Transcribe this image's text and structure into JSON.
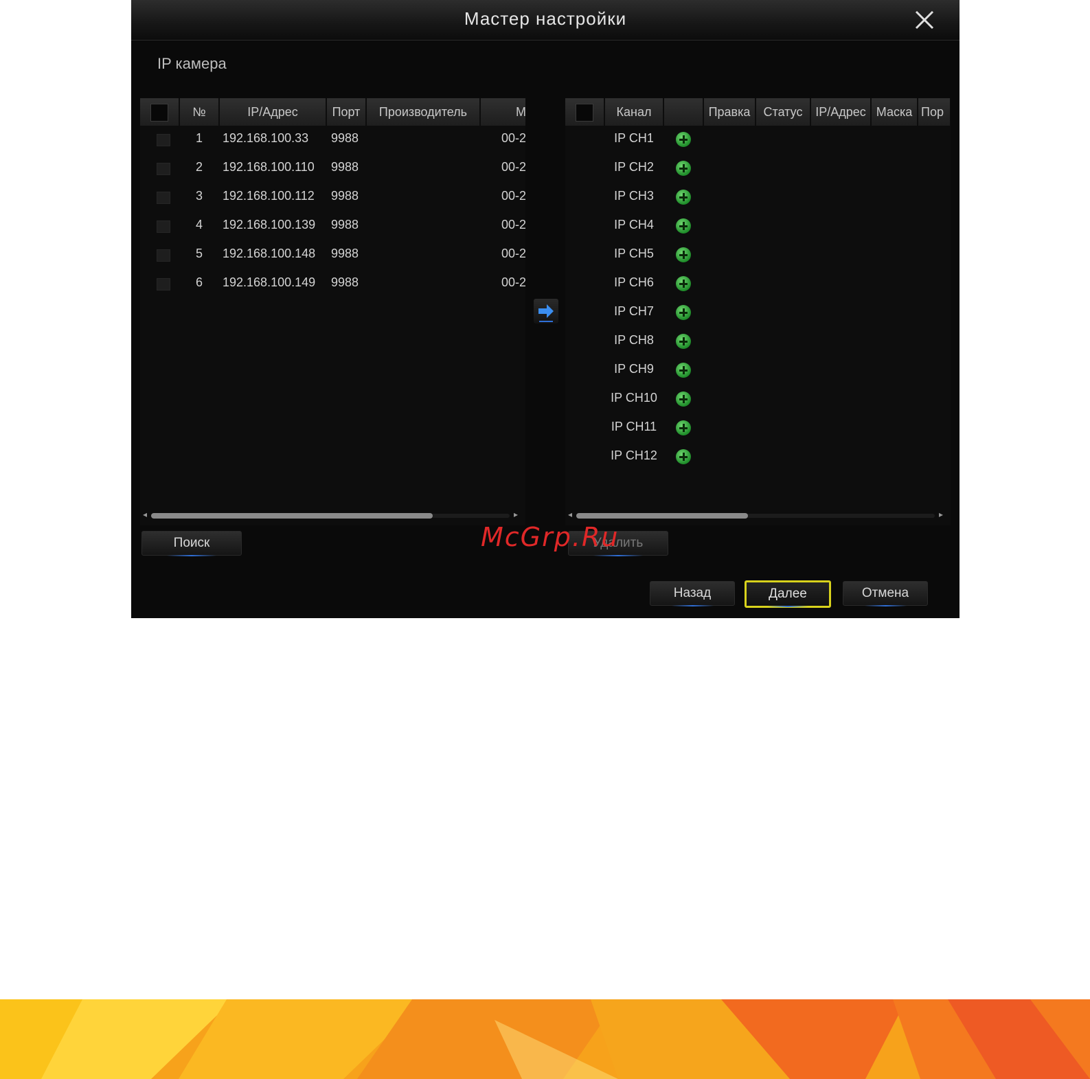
{
  "dialog": {
    "title": "Мастер настройки",
    "section_title": "IP камера"
  },
  "left_table": {
    "headers": [
      "№",
      "IP/Адрес",
      "Порт",
      "Производитель",
      "M"
    ],
    "rows": [
      {
        "no": "1",
        "ip": "192.168.100.33",
        "port": "9988",
        "mac": "00-2"
      },
      {
        "no": "2",
        "ip": "192.168.100.110",
        "port": "9988",
        "mac": "00-2"
      },
      {
        "no": "3",
        "ip": "192.168.100.112",
        "port": "9988",
        "mac": "00-2"
      },
      {
        "no": "4",
        "ip": "192.168.100.139",
        "port": "9988",
        "mac": "00-2"
      },
      {
        "no": "5",
        "ip": "192.168.100.148",
        "port": "9988",
        "mac": "00-2"
      },
      {
        "no": "6",
        "ip": "192.168.100.149",
        "port": "9988",
        "mac": "00-2"
      }
    ]
  },
  "right_table": {
    "headers": [
      "Канал",
      "",
      "Правка",
      "Статус",
      "IP/Адрес",
      "Маска",
      "Пор"
    ],
    "channels": [
      "IP CH1",
      "IP CH2",
      "IP CH3",
      "IP CH4",
      "IP CH5",
      "IP CH6",
      "IP CH7",
      "IP CH8",
      "IP CH9",
      "IP CH10",
      "IP CH11",
      "IP CH12"
    ]
  },
  "buttons": {
    "search": "Поиск",
    "delete": "Удалить",
    "back": "Назад",
    "next": "Далее",
    "cancel": "Отмена"
  },
  "watermark": "McGrp.Ru",
  "colors": {
    "dialog_bg": "#0a0a0a",
    "add_icon": "#2fa43a",
    "primary_border": "#d8d21c",
    "accent_blue": "#2f6fd8",
    "watermark": "#e02828"
  }
}
